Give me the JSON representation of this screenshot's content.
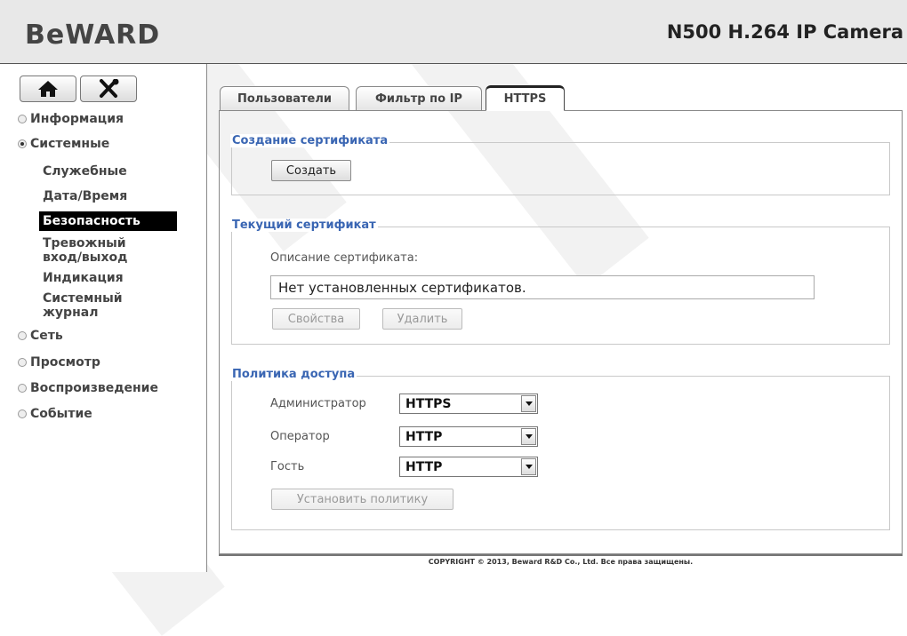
{
  "header": {
    "logo": "BeWARD",
    "camera_title": "N500 H.264 IP Camera"
  },
  "sidebar": {
    "home_icon": "home-icon",
    "settings_icon": "tools-icon",
    "items": [
      {
        "label": "Информация",
        "selected": false
      },
      {
        "label": "Системные",
        "selected": true
      },
      {
        "label": "Сеть",
        "selected": false
      },
      {
        "label": "Просмотр",
        "selected": false
      },
      {
        "label": "Воспроизведение",
        "selected": false
      },
      {
        "label": "Событие",
        "selected": false
      }
    ],
    "sub_items": [
      {
        "label": "Служебные"
      },
      {
        "label": "Дата/Время"
      },
      {
        "label": "Безопасность",
        "active": true
      },
      {
        "label": "Тревожный вход/выход"
      },
      {
        "label": "Индикация"
      },
      {
        "label": "Системный журнал"
      }
    ]
  },
  "tabs": [
    {
      "label": "Пользователи",
      "active": false
    },
    {
      "label": "Фильтр по IP",
      "active": false
    },
    {
      "label": "HTTPS",
      "active": true
    }
  ],
  "create_cert": {
    "legend": "Создание сертификата",
    "create_button": "Создать"
  },
  "current_cert": {
    "legend": "Текущий сертификат",
    "description_label": "Описание сертификата:",
    "description_value": "Нет установленных сертификатов.",
    "properties_button": "Свойства",
    "delete_button": "Удалить"
  },
  "policy": {
    "legend": "Политика доступа",
    "rows": [
      {
        "label": "Администратор",
        "value": "HTTPS"
      },
      {
        "label": "Оператор",
        "value": "HTTP"
      },
      {
        "label": "Гость",
        "value": "HTTP"
      }
    ],
    "apply_button": "Установить политику"
  },
  "footer": {
    "copyright": "COPYRIGHT © 2013, Beward R&D Co., Ltd. Все права защищены."
  },
  "colors": {
    "legend": "#3a66b3",
    "active_nav": "#000000",
    "header_bg": "#e8e8e8"
  }
}
